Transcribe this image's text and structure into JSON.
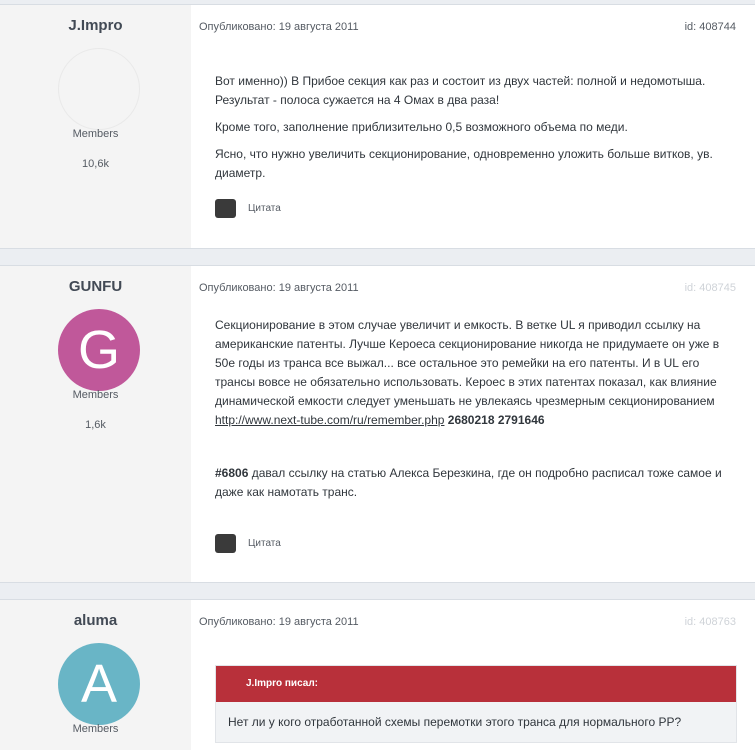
{
  "posts": [
    {
      "author": "J.Impro",
      "avatar_letter": "",
      "avatar_color": "",
      "group": "Members",
      "post_count": "10,6k",
      "published": "Опубликовано: 19 августа 2011",
      "id": "id: 408744",
      "paragraphs": [
        "Вот именно)) В Прибое секция как раз и состоит из двух частей: полной и недомотыша. Результат - полоса сужается на 4 Омах в два раза!",
        "Кроме того, заполнение приблизительно 0,5 возможного объема по меди.",
        "Ясно, что нужно увеличить секционирование, одновременно уложить больше витков, ув. диаметр."
      ],
      "quote_label": "Цитата"
    },
    {
      "author": "GUNFU",
      "avatar_letter": "G",
      "avatar_color": "#c0589a",
      "group": "Members",
      "post_count": "1,6k",
      "published": "Опубликовано: 19 августа 2011",
      "id": "id: 408745",
      "paragraph1": "Секционирование в этом случае увеличит и емкость. В ветке UL я приводил ссылку на американские патенты. Лучше Кероеса секционирование никогда не придумаете он уже в 50е годы из транса все выжал... все остальное это ремейки на его патенты. И в UL его трансы вовсе не обязательно использовать. Кероес в этих патентах показал, как влияние динамической емкости следует уменьшать не увлекаясь чрезмерным секционированием",
      "link": "http://www.next-tube.com/ru/remember.php",
      "patents": "2680218 2791646",
      "ref_num": "#6806",
      "paragraph2": " давал ссылку на статью Алекса Березкина, где он подробно расписал тоже самое и даже как намотать транс.",
      "quote_label": "Цитата"
    },
    {
      "author": "aluma",
      "avatar_letter": "A",
      "avatar_color": "#69b5c6",
      "group": "Members",
      "published": "Опубликовано: 19 августа 2011",
      "id": "id: 408763",
      "citation_head": "J.Impro писал:",
      "citation_text": "Нет ли у кого отработанной схемы перемотки этого транса для нормального РР?"
    }
  ]
}
